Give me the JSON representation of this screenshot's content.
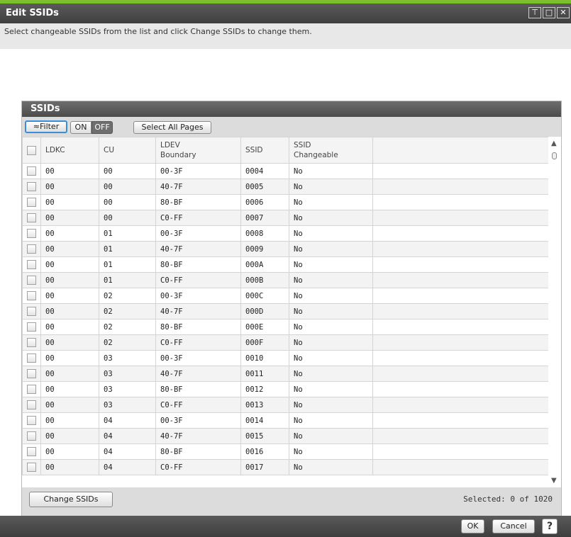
{
  "dialog": {
    "title": "Edit SSIDs",
    "description": "Select changeable SSIDs from the list and click Change SSIDs to change them."
  },
  "panel": {
    "title": "SSIDs",
    "filter_label": "≈Filter",
    "on_label": "ON",
    "off_label": "OFF",
    "select_all_label": "Select All Pages",
    "columns": [
      "LDKC",
      "CU",
      "LDEV\nBoundary",
      "SSID",
      "SSID\nChangeable"
    ],
    "rows": [
      {
        "ldkc": "00",
        "cu": "00",
        "boundary": "00-3F",
        "ssid": "0004",
        "changeable": "No"
      },
      {
        "ldkc": "00",
        "cu": "00",
        "boundary": "40-7F",
        "ssid": "0005",
        "changeable": "No"
      },
      {
        "ldkc": "00",
        "cu": "00",
        "boundary": "80-BF",
        "ssid": "0006",
        "changeable": "No"
      },
      {
        "ldkc": "00",
        "cu": "00",
        "boundary": "C0-FF",
        "ssid": "0007",
        "changeable": "No"
      },
      {
        "ldkc": "00",
        "cu": "01",
        "boundary": "00-3F",
        "ssid": "0008",
        "changeable": "No"
      },
      {
        "ldkc": "00",
        "cu": "01",
        "boundary": "40-7F",
        "ssid": "0009",
        "changeable": "No"
      },
      {
        "ldkc": "00",
        "cu": "01",
        "boundary": "80-BF",
        "ssid": "000A",
        "changeable": "No"
      },
      {
        "ldkc": "00",
        "cu": "01",
        "boundary": "C0-FF",
        "ssid": "000B",
        "changeable": "No"
      },
      {
        "ldkc": "00",
        "cu": "02",
        "boundary": "00-3F",
        "ssid": "000C",
        "changeable": "No"
      },
      {
        "ldkc": "00",
        "cu": "02",
        "boundary": "40-7F",
        "ssid": "000D",
        "changeable": "No"
      },
      {
        "ldkc": "00",
        "cu": "02",
        "boundary": "80-BF",
        "ssid": "000E",
        "changeable": "No"
      },
      {
        "ldkc": "00",
        "cu": "02",
        "boundary": "C0-FF",
        "ssid": "000F",
        "changeable": "No"
      },
      {
        "ldkc": "00",
        "cu": "03",
        "boundary": "00-3F",
        "ssid": "0010",
        "changeable": "No"
      },
      {
        "ldkc": "00",
        "cu": "03",
        "boundary": "40-7F",
        "ssid": "0011",
        "changeable": "No"
      },
      {
        "ldkc": "00",
        "cu": "03",
        "boundary": "80-BF",
        "ssid": "0012",
        "changeable": "No"
      },
      {
        "ldkc": "00",
        "cu": "03",
        "boundary": "C0-FF",
        "ssid": "0013",
        "changeable": "No"
      },
      {
        "ldkc": "00",
        "cu": "04",
        "boundary": "00-3F",
        "ssid": "0014",
        "changeable": "No"
      },
      {
        "ldkc": "00",
        "cu": "04",
        "boundary": "40-7F",
        "ssid": "0015",
        "changeable": "No"
      },
      {
        "ldkc": "00",
        "cu": "04",
        "boundary": "80-BF",
        "ssid": "0016",
        "changeable": "No"
      },
      {
        "ldkc": "00",
        "cu": "04",
        "boundary": "C0-FF",
        "ssid": "0017",
        "changeable": "No"
      }
    ],
    "change_button": "Change SSIDs",
    "selected_label": "Selected:",
    "selected_count": "0",
    "of_label": "of",
    "total_count": "1020"
  },
  "footer": {
    "ok": "OK",
    "cancel": "Cancel",
    "help": "?"
  },
  "icons": {
    "pin": "pin-icon",
    "maximize": "maximize-icon",
    "close": "close-icon",
    "filter": "double-chevron-up-icon",
    "scroll_up": "chevron-up-icon",
    "scroll_down": "chevron-down-icon"
  }
}
